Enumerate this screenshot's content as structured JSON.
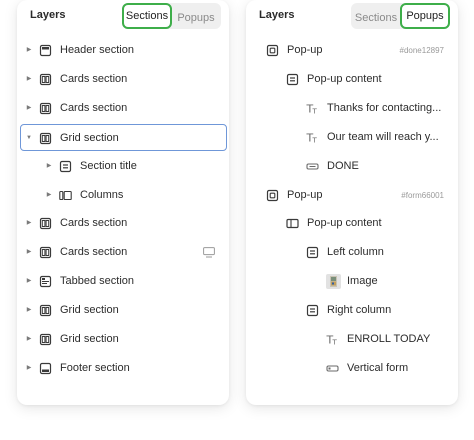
{
  "left_panel": {
    "title": "Layers",
    "tabs": [
      {
        "label": "Sections",
        "active": true
      },
      {
        "label": "Popups",
        "active": false
      }
    ],
    "items": [
      {
        "label": "Header section",
        "icon": "header-section-icon",
        "has_caret": true,
        "depth": 0
      },
      {
        "label": "Cards section",
        "icon": "cards-section-icon",
        "has_caret": true,
        "depth": 0
      },
      {
        "label": "Cards section",
        "icon": "cards-section-icon",
        "has_caret": true,
        "depth": 0
      },
      {
        "label": "Grid section",
        "icon": "grid-section-icon",
        "has_caret": true,
        "expanded": true,
        "selected": true,
        "depth": 0
      },
      {
        "label": "Section title",
        "icon": "section-title-icon",
        "has_caret": true,
        "depth": 1
      },
      {
        "label": "Columns",
        "icon": "columns-icon",
        "has_caret": true,
        "depth": 1
      },
      {
        "label": "Cards section",
        "icon": "cards-section-icon",
        "has_caret": true,
        "depth": 0
      },
      {
        "label": "Cards section",
        "icon": "cards-section-icon",
        "has_caret": true,
        "depth": 0,
        "extra_icon": "desktop-icon"
      },
      {
        "label": "Tabbed section",
        "icon": "tabbed-section-icon",
        "has_caret": true,
        "depth": 0
      },
      {
        "label": "Grid section",
        "icon": "grid-section-icon",
        "has_caret": true,
        "depth": 0
      },
      {
        "label": "Grid section",
        "icon": "grid-section-icon",
        "has_caret": true,
        "depth": 0
      },
      {
        "label": "Footer section",
        "icon": "footer-section-icon",
        "has_caret": true,
        "depth": 0
      }
    ]
  },
  "right_panel": {
    "title": "Layers",
    "tabs": [
      {
        "label": "Sections",
        "active": false
      },
      {
        "label": "Popups",
        "active": true
      }
    ],
    "items": [
      {
        "label": "Pop-up",
        "icon": "popup-icon",
        "depth": 0,
        "tag": "#done12897"
      },
      {
        "label": "Pop-up content",
        "icon": "popup-content-icon",
        "depth": 1
      },
      {
        "label": "Thanks for contacting...",
        "icon": "text-icon",
        "depth": 2
      },
      {
        "label": "Our team will reach y...",
        "icon": "text-icon",
        "depth": 2
      },
      {
        "label": "DONE",
        "icon": "button-icon",
        "depth": 2
      },
      {
        "label": "Pop-up",
        "icon": "popup-icon",
        "depth": 0,
        "tag": "#form66001"
      },
      {
        "label": "Pop-up content",
        "icon": "columns-content-icon",
        "depth": 1
      },
      {
        "label": "Left column",
        "icon": "column-icon",
        "depth": 2
      },
      {
        "label": "Image",
        "icon": "image-thumbnail-icon",
        "depth": 3
      },
      {
        "label": "Right column",
        "icon": "column-icon",
        "depth": 2
      },
      {
        "label": "ENROLL TODAY",
        "icon": "text-icon",
        "depth": 3
      },
      {
        "label": "Vertical form",
        "icon": "form-icon",
        "depth": 3
      }
    ]
  },
  "colors": {
    "active_tab_border": "#3eae4a",
    "selected_row_border": "#6f97d8",
    "icon_stroke": "#3a3a3a",
    "muted_text": "#9a9a9a"
  }
}
